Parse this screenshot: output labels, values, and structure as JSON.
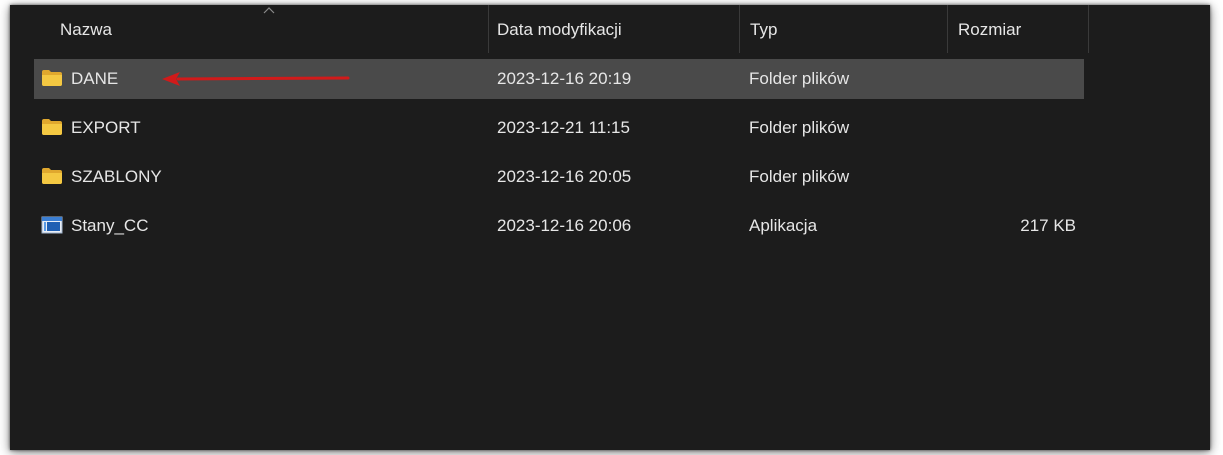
{
  "columns": {
    "name": "Nazwa",
    "date": "Data modyfikacji",
    "type": "Typ",
    "size": "Rozmiar"
  },
  "rows": [
    {
      "name": "DANE",
      "date": "2023-12-16 20:19",
      "type": "Folder plików",
      "size": "",
      "icon": "folder-icon",
      "selected": true
    },
    {
      "name": "EXPORT",
      "date": "2023-12-21 11:15",
      "type": "Folder plików",
      "size": "",
      "icon": "folder-icon",
      "selected": false
    },
    {
      "name": "SZABLONY",
      "date": "2023-12-16 20:05",
      "type": "Folder plików",
      "size": "",
      "icon": "folder-icon",
      "selected": false
    },
    {
      "name": "Stany_CC",
      "date": "2023-12-16 20:06",
      "type": "Aplikacja",
      "size": "217 KB",
      "icon": "application-icon",
      "selected": false
    }
  ],
  "colors": {
    "background": "#1c1c1c",
    "selected_row": "#4a4a4a",
    "text": "#e6e6e6",
    "folder": "#f4c842",
    "annotation_arrow": "#d11a1a"
  },
  "annotation": "red-arrow-pointing-to-DANE"
}
